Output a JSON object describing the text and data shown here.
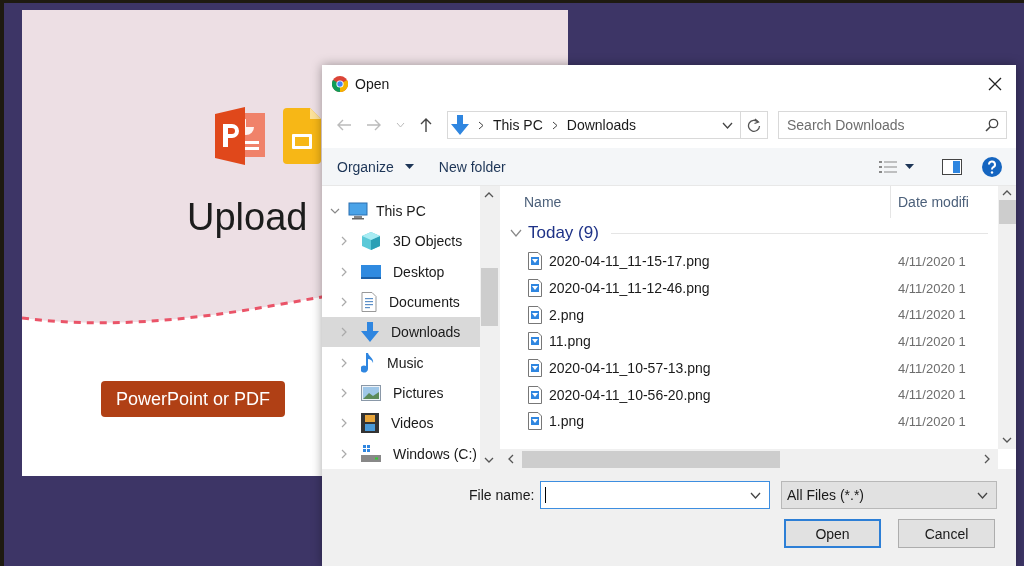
{
  "page": {
    "title": "Upload",
    "button": "PowerPoint or PDF"
  },
  "dialog": {
    "title": "Open",
    "breadcrumbs": [
      "This PC",
      "Downloads"
    ],
    "search": {
      "placeholder": "Search Downloads"
    },
    "toolbar": {
      "organize": "Organize",
      "new_folder": "New folder"
    },
    "nav_tree": [
      {
        "label": "This PC",
        "kind": "pc",
        "expanded": true,
        "selected": false,
        "children": [
          {
            "label": "3D Objects",
            "kind": "cube",
            "expanded": false,
            "selected": false
          },
          {
            "label": "Desktop",
            "kind": "desktop",
            "expanded": false,
            "selected": false
          },
          {
            "label": "Documents",
            "kind": "documents",
            "expanded": false,
            "selected": false
          },
          {
            "label": "Downloads",
            "kind": "downloads",
            "expanded": false,
            "selected": true
          },
          {
            "label": "Music",
            "kind": "music",
            "expanded": false,
            "selected": false
          },
          {
            "label": "Pictures",
            "kind": "pictures",
            "expanded": false,
            "selected": false
          },
          {
            "label": "Videos",
            "kind": "videos",
            "expanded": false,
            "selected": false
          },
          {
            "label": "Windows (C:)",
            "kind": "drive",
            "expanded": false,
            "selected": false
          }
        ]
      }
    ],
    "columns": [
      "Name",
      "Date modifi"
    ],
    "group": {
      "label": "Today (9)",
      "expanded": true
    },
    "files": [
      {
        "name": "2020-04-11_11-15-17.png",
        "date": "4/11/2020 1"
      },
      {
        "name": "2020-04-11_11-12-46.png",
        "date": "4/11/2020 1"
      },
      {
        "name": "2.png",
        "date": "4/11/2020 1"
      },
      {
        "name": "11.png",
        "date": "4/11/2020 1"
      },
      {
        "name": "2020-04-11_10-57-13.png",
        "date": "4/11/2020 1"
      },
      {
        "name": "2020-04-11_10-56-20.png",
        "date": "4/11/2020 1"
      },
      {
        "name": "1.png",
        "date": "4/11/2020 1"
      }
    ],
    "file_name_label": "File name:",
    "filter": "All Files (*.*)",
    "buttons": [
      {
        "label": "Open",
        "kind": "default"
      },
      {
        "label": "Cancel",
        "kind": "normal"
      }
    ]
  }
}
